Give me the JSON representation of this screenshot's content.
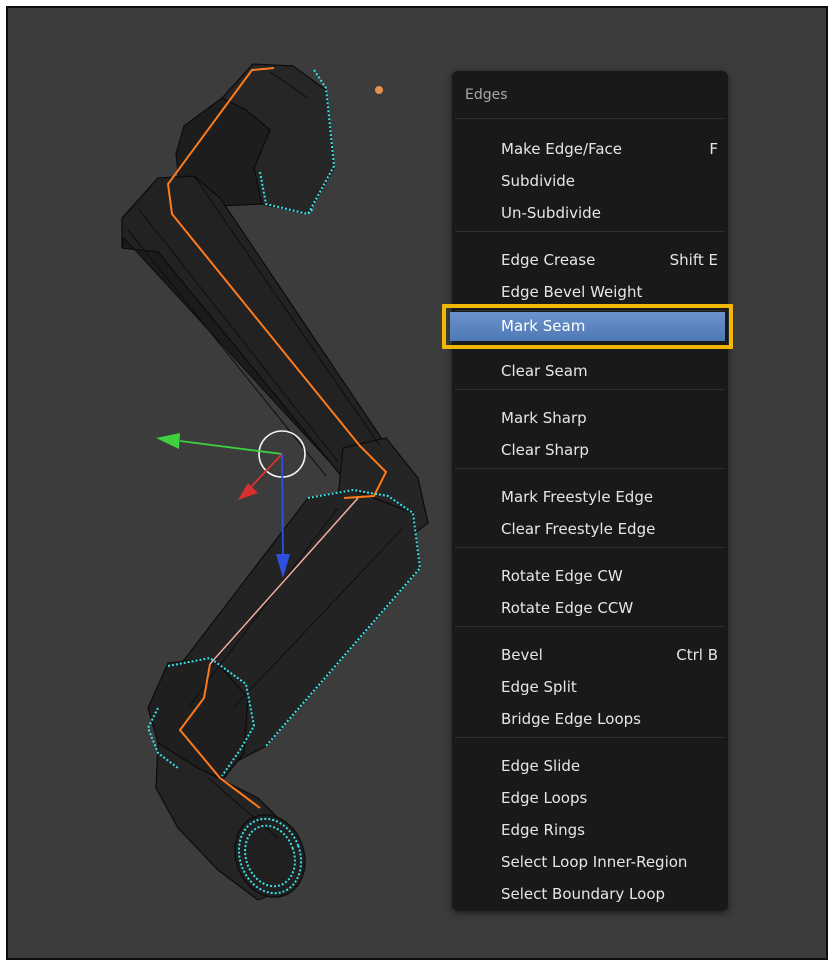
{
  "menu": {
    "title": "Edges",
    "items": [
      {
        "label": "Make Edge/Face",
        "shortcut": "F"
      },
      {
        "label": "Subdivide",
        "shortcut": ""
      },
      {
        "label": "Un-Subdivide",
        "shortcut": ""
      },
      {
        "label": "Edge Crease",
        "shortcut": "Shift E"
      },
      {
        "label": "Edge Bevel Weight",
        "shortcut": ""
      },
      {
        "label": "Mark Seam",
        "shortcut": ""
      },
      {
        "label": "Clear Seam",
        "shortcut": ""
      },
      {
        "label": "Mark Sharp",
        "shortcut": ""
      },
      {
        "label": "Clear Sharp",
        "shortcut": ""
      },
      {
        "label": "Mark Freestyle Edge",
        "shortcut": ""
      },
      {
        "label": "Clear Freestyle Edge",
        "shortcut": ""
      },
      {
        "label": "Rotate Edge CW",
        "shortcut": ""
      },
      {
        "label": "Rotate Edge CCW",
        "shortcut": ""
      },
      {
        "label": "Bevel",
        "shortcut": "Ctrl B"
      },
      {
        "label": "Edge Split",
        "shortcut": ""
      },
      {
        "label": "Bridge Edge Loops",
        "shortcut": ""
      },
      {
        "label": "Edge Slide",
        "shortcut": ""
      },
      {
        "label": "Edge Loops",
        "shortcut": ""
      },
      {
        "label": "Edge Rings",
        "shortcut": ""
      },
      {
        "label": "Select Loop Inner-Region",
        "shortcut": ""
      },
      {
        "label": "Select Boundary Loop",
        "shortcut": ""
      }
    ],
    "highlighted_item": "Mark Seam"
  },
  "colors": {
    "viewport_bg": "#3c3c3c",
    "menu_bg": "#191919",
    "highlight": "#5a82bd",
    "callout": "#f2b705",
    "seam": "#ff7a1a",
    "selected_edge": "#38e0e8",
    "axis_x": "#d83030",
    "axis_y": "#3fcf3f",
    "axis_z": "#2f4fe0"
  },
  "icons": {
    "manipulator": "transform-manipulator-icon",
    "pivot": "3d-cursor-icon"
  }
}
